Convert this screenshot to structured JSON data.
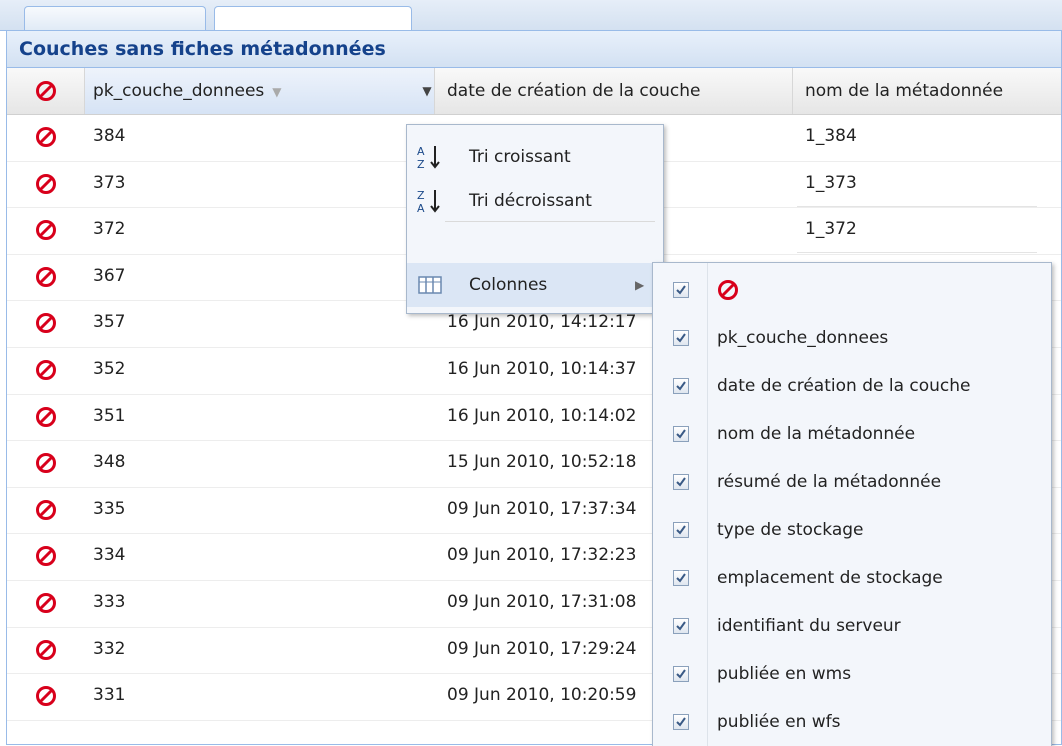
{
  "panel": {
    "title": "Couches sans fiches métadonnées"
  },
  "columns": {
    "pk": "pk_couche_donnees",
    "date": "date de création de la couche",
    "nom": "nom de la métadonnée"
  },
  "rows": [
    {
      "pk": "384",
      "date": "",
      "nom": "1_384"
    },
    {
      "pk": "373",
      "date": "",
      "nom": "1_373"
    },
    {
      "pk": "372",
      "date": "",
      "nom": "1_372"
    },
    {
      "pk": "367",
      "date": "",
      "nom": ""
    },
    {
      "pk": "357",
      "date": "16 Jun 2010, 14:12:17",
      "nom": ""
    },
    {
      "pk": "352",
      "date": "16 Jun 2010, 10:14:37",
      "nom": ""
    },
    {
      "pk": "351",
      "date": "16 Jun 2010, 10:14:02",
      "nom": ""
    },
    {
      "pk": "348",
      "date": "15 Jun 2010, 10:52:18",
      "nom": ""
    },
    {
      "pk": "335",
      "date": "09 Jun 2010, 17:37:34",
      "nom": ""
    },
    {
      "pk": "334",
      "date": "09 Jun 2010, 17:32:23",
      "nom": ""
    },
    {
      "pk": "333",
      "date": "09 Jun 2010, 17:31:08",
      "nom": ""
    },
    {
      "pk": "332",
      "date": "09 Jun 2010, 17:29:24",
      "nom": ""
    },
    {
      "pk": "331",
      "date": "09 Jun 2010, 10:20:59",
      "nom": ""
    }
  ],
  "menu": {
    "sort_asc": "Tri croissant",
    "sort_desc": "Tri décroissant",
    "columns": "Colonnes"
  },
  "submenu": {
    "items": [
      {
        "label": "",
        "checked": true,
        "icon": "no-entry-icon"
      },
      {
        "label": "pk_couche_donnees",
        "checked": true
      },
      {
        "label": "date de création de la couche",
        "checked": true
      },
      {
        "label": "nom de la métadonnée",
        "checked": true
      },
      {
        "label": "résumé de la métadonnée",
        "checked": true
      },
      {
        "label": "type de stockage",
        "checked": true
      },
      {
        "label": "emplacement de stockage",
        "checked": true
      },
      {
        "label": "identifiant du serveur",
        "checked": true
      },
      {
        "label": "publiée en wms",
        "checked": true
      },
      {
        "label": "publiée en wfs",
        "checked": true
      }
    ]
  },
  "colors": {
    "title": "#15428b",
    "no_entry_icon": "#d8001b"
  }
}
